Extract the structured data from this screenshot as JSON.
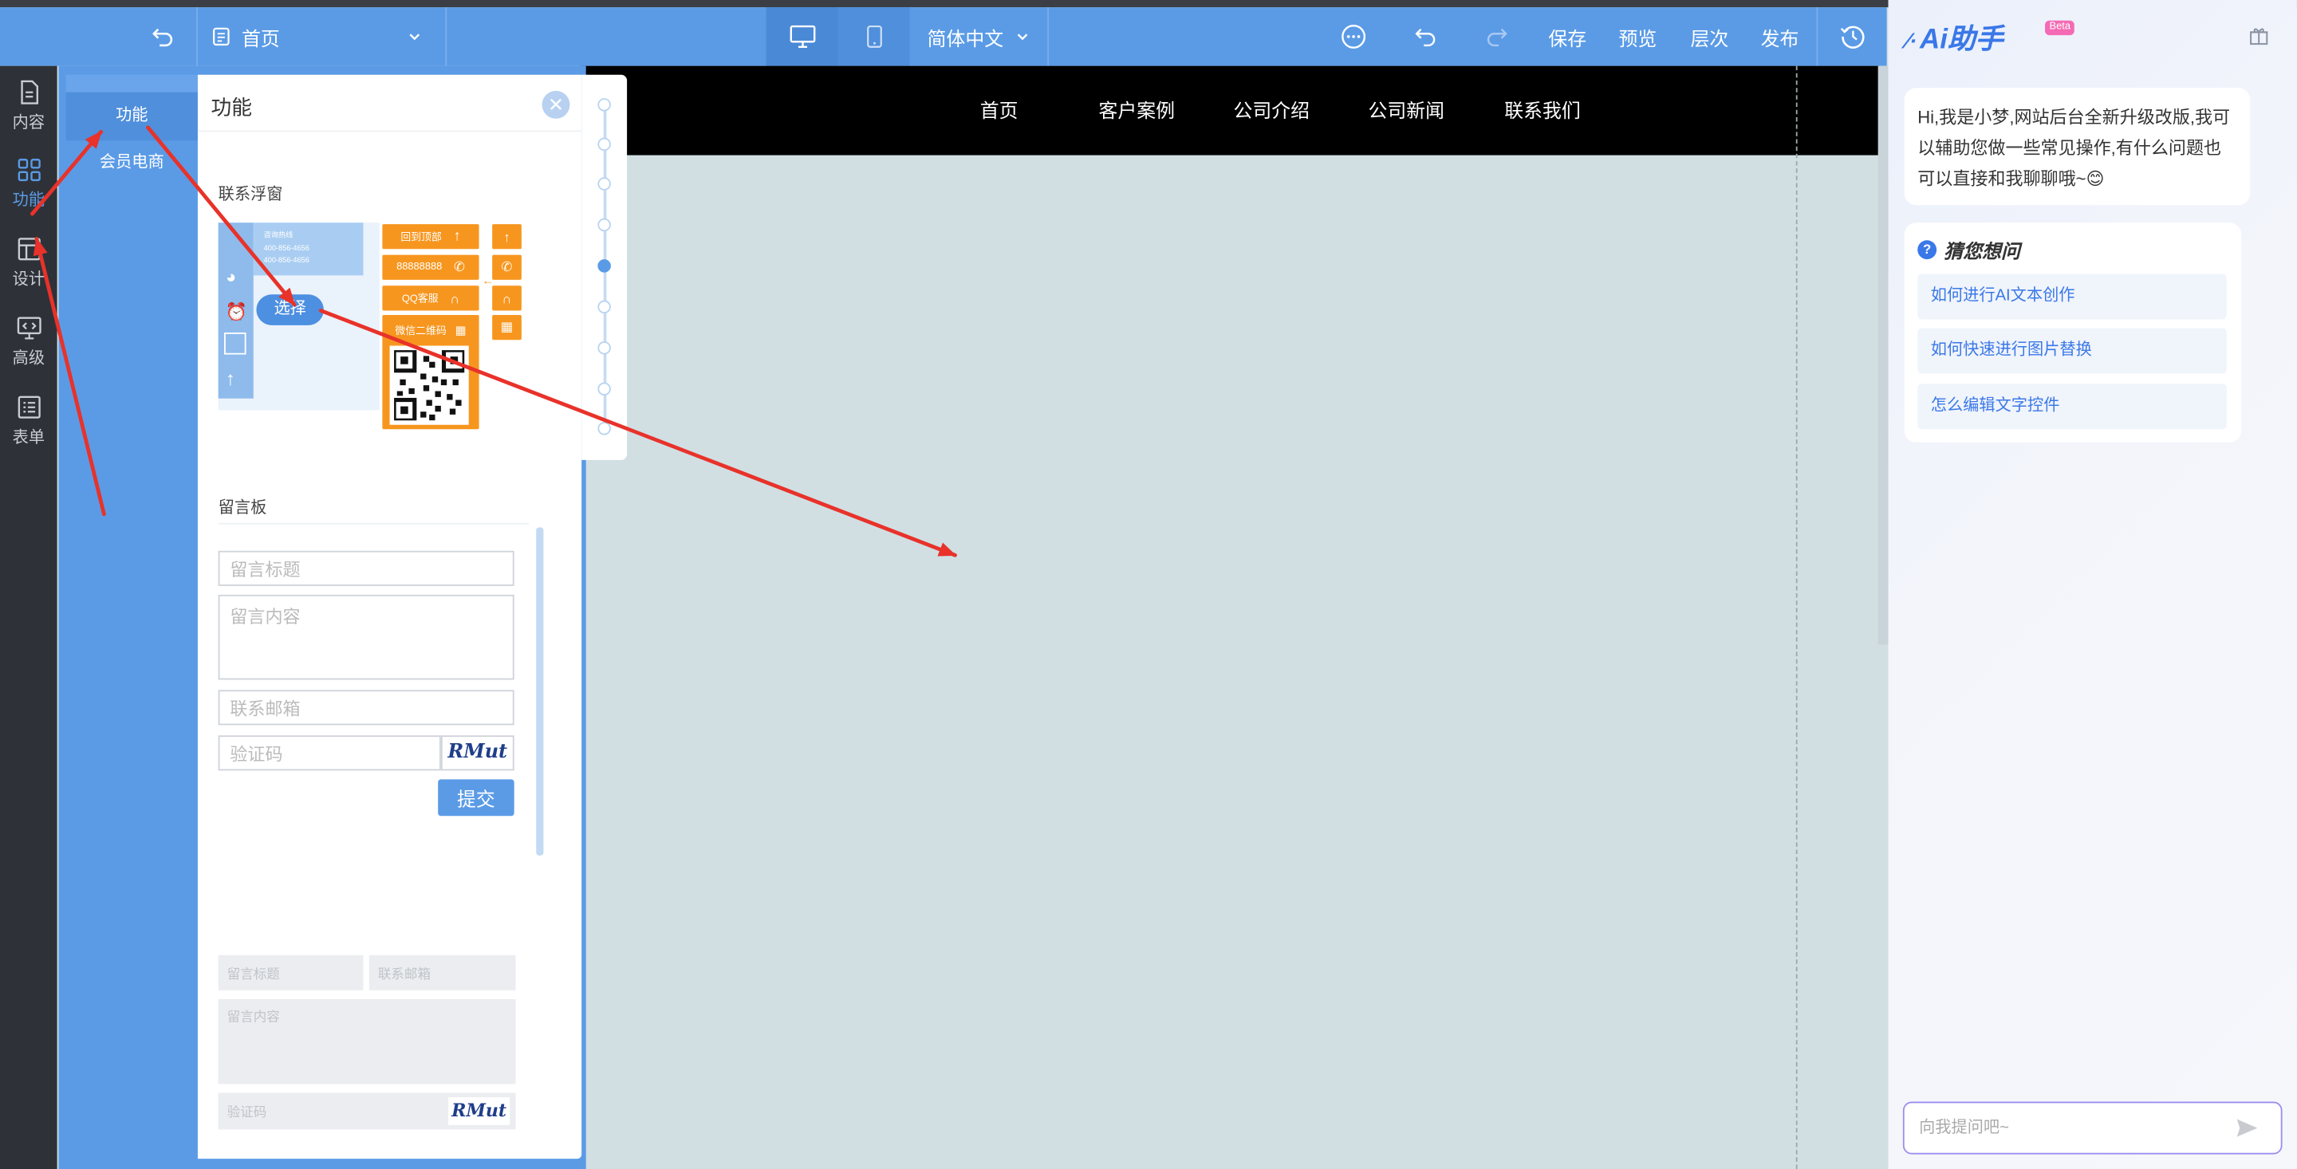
{
  "topbar": {
    "page_select": "首页",
    "language": "简体中文",
    "save": "保存",
    "preview": "预览",
    "layers": "层次",
    "publish": "发布"
  },
  "sidebar": {
    "items": [
      {
        "label": "内容",
        "icon": "document-icon"
      },
      {
        "label": "功能",
        "icon": "grid-icon"
      },
      {
        "label": "设计",
        "icon": "layout-icon"
      },
      {
        "label": "高级",
        "icon": "code-monitor-icon"
      },
      {
        "label": "表单",
        "icon": "list-icon"
      }
    ]
  },
  "canvas_nav": [
    "首页",
    "客户案例",
    "公司介绍",
    "公司新闻",
    "联系我们"
  ],
  "panel": {
    "title": "功能",
    "tabs": [
      "功能",
      "会员电商"
    ],
    "section_float": "联系浮窗",
    "select_label": "选择",
    "float_preview": {
      "phone_name": "咨询热线",
      "phone1": "400-856-4656",
      "phone2": "400-856-4656",
      "btn_top": "回到顶部",
      "btn_phone": "88888888",
      "btn_qq": "QQ客服",
      "btn_wechat": "微信二维码"
    },
    "section_board": "留言板",
    "board1": {
      "title_ph": "留言标题",
      "content_ph": "留言内容",
      "email_ph": "联系邮箱",
      "captcha_ph": "验证码",
      "captcha_img": "RMut",
      "submit": "提交"
    },
    "board2": {
      "title_ph": "留言标题",
      "email_ph": "联系邮箱",
      "content_ph": "留言内容",
      "captcha_ph": "验证码",
      "captcha_img": "RMut"
    }
  },
  "ai": {
    "logo": "Ai助手",
    "beta": "Beta",
    "greeting": "Hi,我是小梦,网站后台全新升级改版,我可以辅助您做一些常见操作,有什么问题也可以直接和我聊聊哦~😊",
    "guess_title": "猜您想问",
    "suggestions": [
      "如何进行AI文本创作",
      "如何快速进行图片替换",
      "怎么编辑文字控件"
    ],
    "input_placeholder": "向我提问吧~"
  }
}
